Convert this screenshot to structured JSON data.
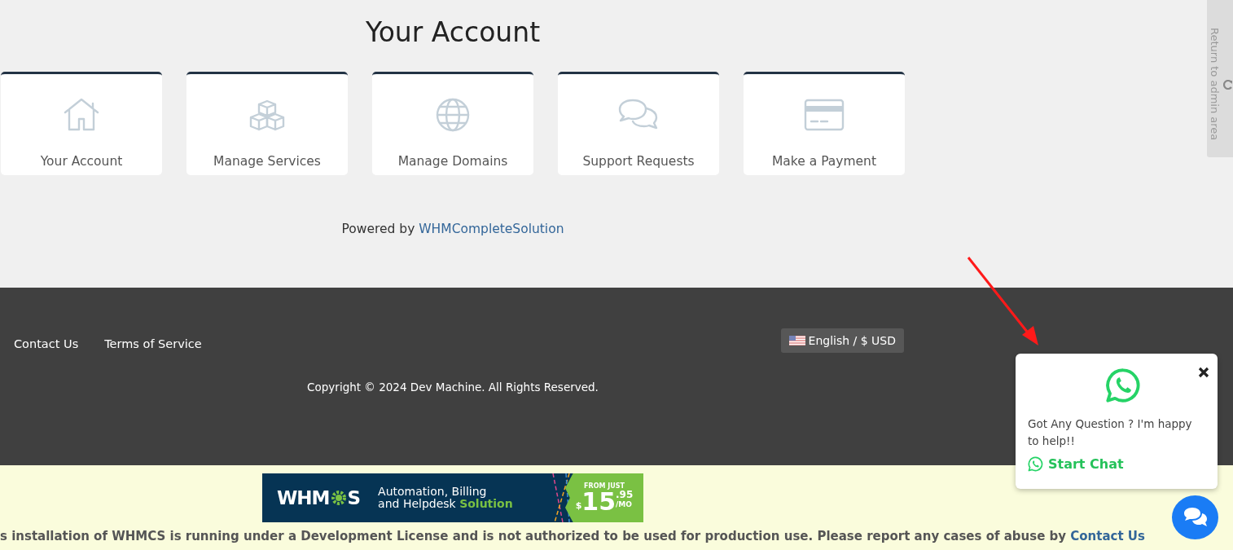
{
  "page_title": "Your Account",
  "tiles": [
    {
      "label": "Your Account",
      "kind": "home"
    },
    {
      "label": "Manage Services",
      "kind": "boxes"
    },
    {
      "label": "Manage Domains",
      "kind": "globe"
    },
    {
      "label": "Support Requests",
      "kind": "chat"
    },
    {
      "label": "Make a Payment",
      "kind": "card"
    }
  ],
  "powered_by": {
    "text": "Powered by",
    "link": "WHMCompleteSolution"
  },
  "footer": {
    "links": [
      "Contact Us",
      "Terms of Service"
    ],
    "language": "English / $ USD",
    "copyright": "Copyright © 2024 Dev Machine. All Rights Reserved."
  },
  "admin_tab": "Return to admin area",
  "ad_banner": {
    "logo_start": "WHM",
    "logo_end": "S",
    "headline_1": "Automation, Billing",
    "headline_2": "and Helpdesk",
    "headline_accent": "Solution",
    "price_prefix": "FROM JUST",
    "currency": "$",
    "price": "15",
    "cents": ".95",
    "period": "/MO"
  },
  "license_notice": {
    "text": "s installation of WHMCS is running under a Development License and is not authorized to be used for production use. Please report any cases of abuse by",
    "link": "Contact Us"
  },
  "chat_popup": {
    "message": "Got Any Question ? I'm happy to help!!",
    "action": "Start Chat"
  }
}
